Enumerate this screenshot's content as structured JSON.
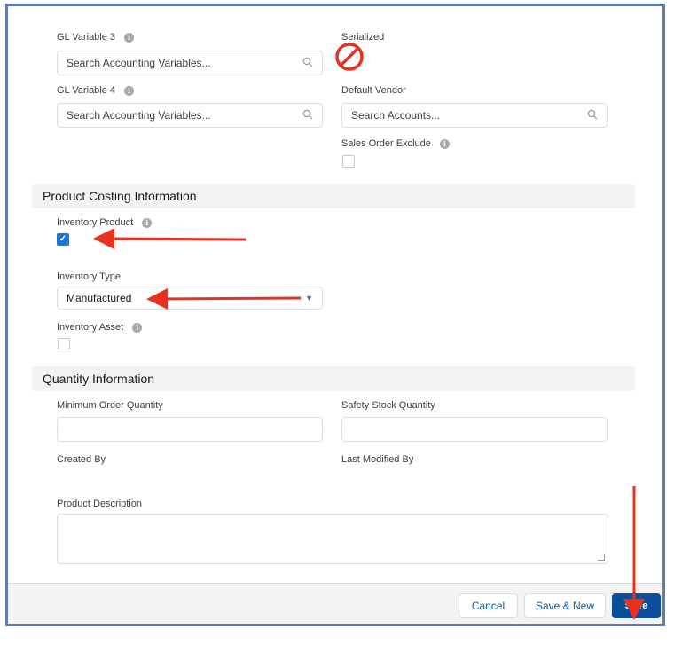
{
  "fields": {
    "gl_variable_3": {
      "label": "GL Variable 3",
      "placeholder": "Search Accounting Variables..."
    },
    "serialized": {
      "label": "Serialized",
      "checked": false
    },
    "gl_variable_4": {
      "label": "GL Variable 4",
      "placeholder": "Search Accounting Variables..."
    },
    "default_vendor": {
      "label": "Default Vendor",
      "placeholder": "Search Accounts..."
    },
    "sales_order_exclude": {
      "label": "Sales Order Exclude",
      "checked": false
    },
    "inventory_product": {
      "label": "Inventory Product",
      "checked": true
    },
    "inventory_type": {
      "label": "Inventory Type",
      "value": "Manufactured"
    },
    "inventory_asset": {
      "label": "Inventory Asset",
      "checked": false
    },
    "minimum_order_quantity": {
      "label": "Minimum Order Quantity",
      "value": ""
    },
    "safety_stock_quantity": {
      "label": "Safety Stock Quantity",
      "value": ""
    },
    "created_by": {
      "label": "Created By"
    },
    "last_modified_by": {
      "label": "Last Modified By"
    },
    "product_description": {
      "label": "Product Description",
      "value": ""
    }
  },
  "sections": {
    "product_costing": "Product Costing Information",
    "quantity": "Quantity Information"
  },
  "footer": {
    "cancel_label": "Cancel",
    "save_new_label": "Save & New",
    "save_label": "Save"
  },
  "icons": {
    "info": "info-icon",
    "search": "search-icon",
    "dropdown": "chevron-down-icon",
    "checkmark": "check-icon",
    "prohibited": "no-symbol-icon"
  },
  "colors": {
    "annotation_red": "#e8321f",
    "primary_button": "#0b4f9c",
    "checkbox_checked": "#1b74d6",
    "frame_border": "#5d7fb0"
  }
}
